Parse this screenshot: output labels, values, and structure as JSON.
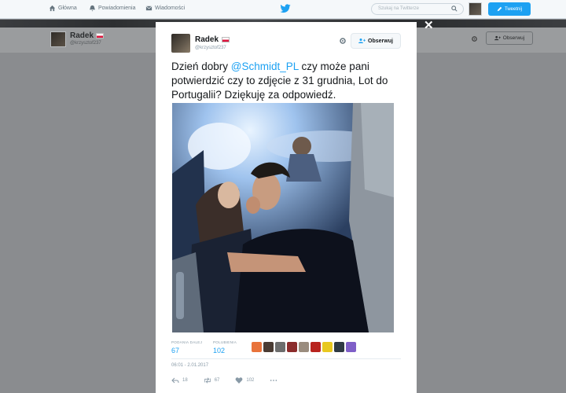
{
  "nav": {
    "home": "Główna",
    "notifications": "Powiadomienia",
    "messages": "Wiadomości"
  },
  "search": {
    "placeholder": "Szukaj na Twitterze"
  },
  "tweet_button": "Tweetnij",
  "profile": {
    "name": "Radek",
    "handle": "@krzysztof237",
    "follow_label": "Obserwuj"
  },
  "tweet": {
    "author_name": "Radek",
    "author_handle": "@krzysztof237",
    "follow_label": "Obserwuj",
    "text_before": "Dzień dobry ",
    "mention": "@Schmidt_PL",
    "text_after": " czy może pani potwierdzić czy to zdjęcie z 31 grudnia, Lot do Portugalii? Dziękuję za odpowiedź.",
    "retweets_label": "PODANIA DALEJ",
    "retweets": "67",
    "likes_label": "POLUBIENIA",
    "likes": "102",
    "timestamp": "06:01 - 2.01.2017",
    "reply_count": "18",
    "retweet_count": "67",
    "like_count": "102"
  },
  "icons": [
    "home-icon",
    "bell-icon",
    "envelope-icon",
    "twitter-bird-icon",
    "search-icon",
    "gear-icon",
    "add-user-icon",
    "close-icon",
    "reply-icon",
    "retweet-icon",
    "heart-icon",
    "more-icon"
  ],
  "colors": {
    "accent": "#1da1f2",
    "flag_red": "#dc143c"
  }
}
